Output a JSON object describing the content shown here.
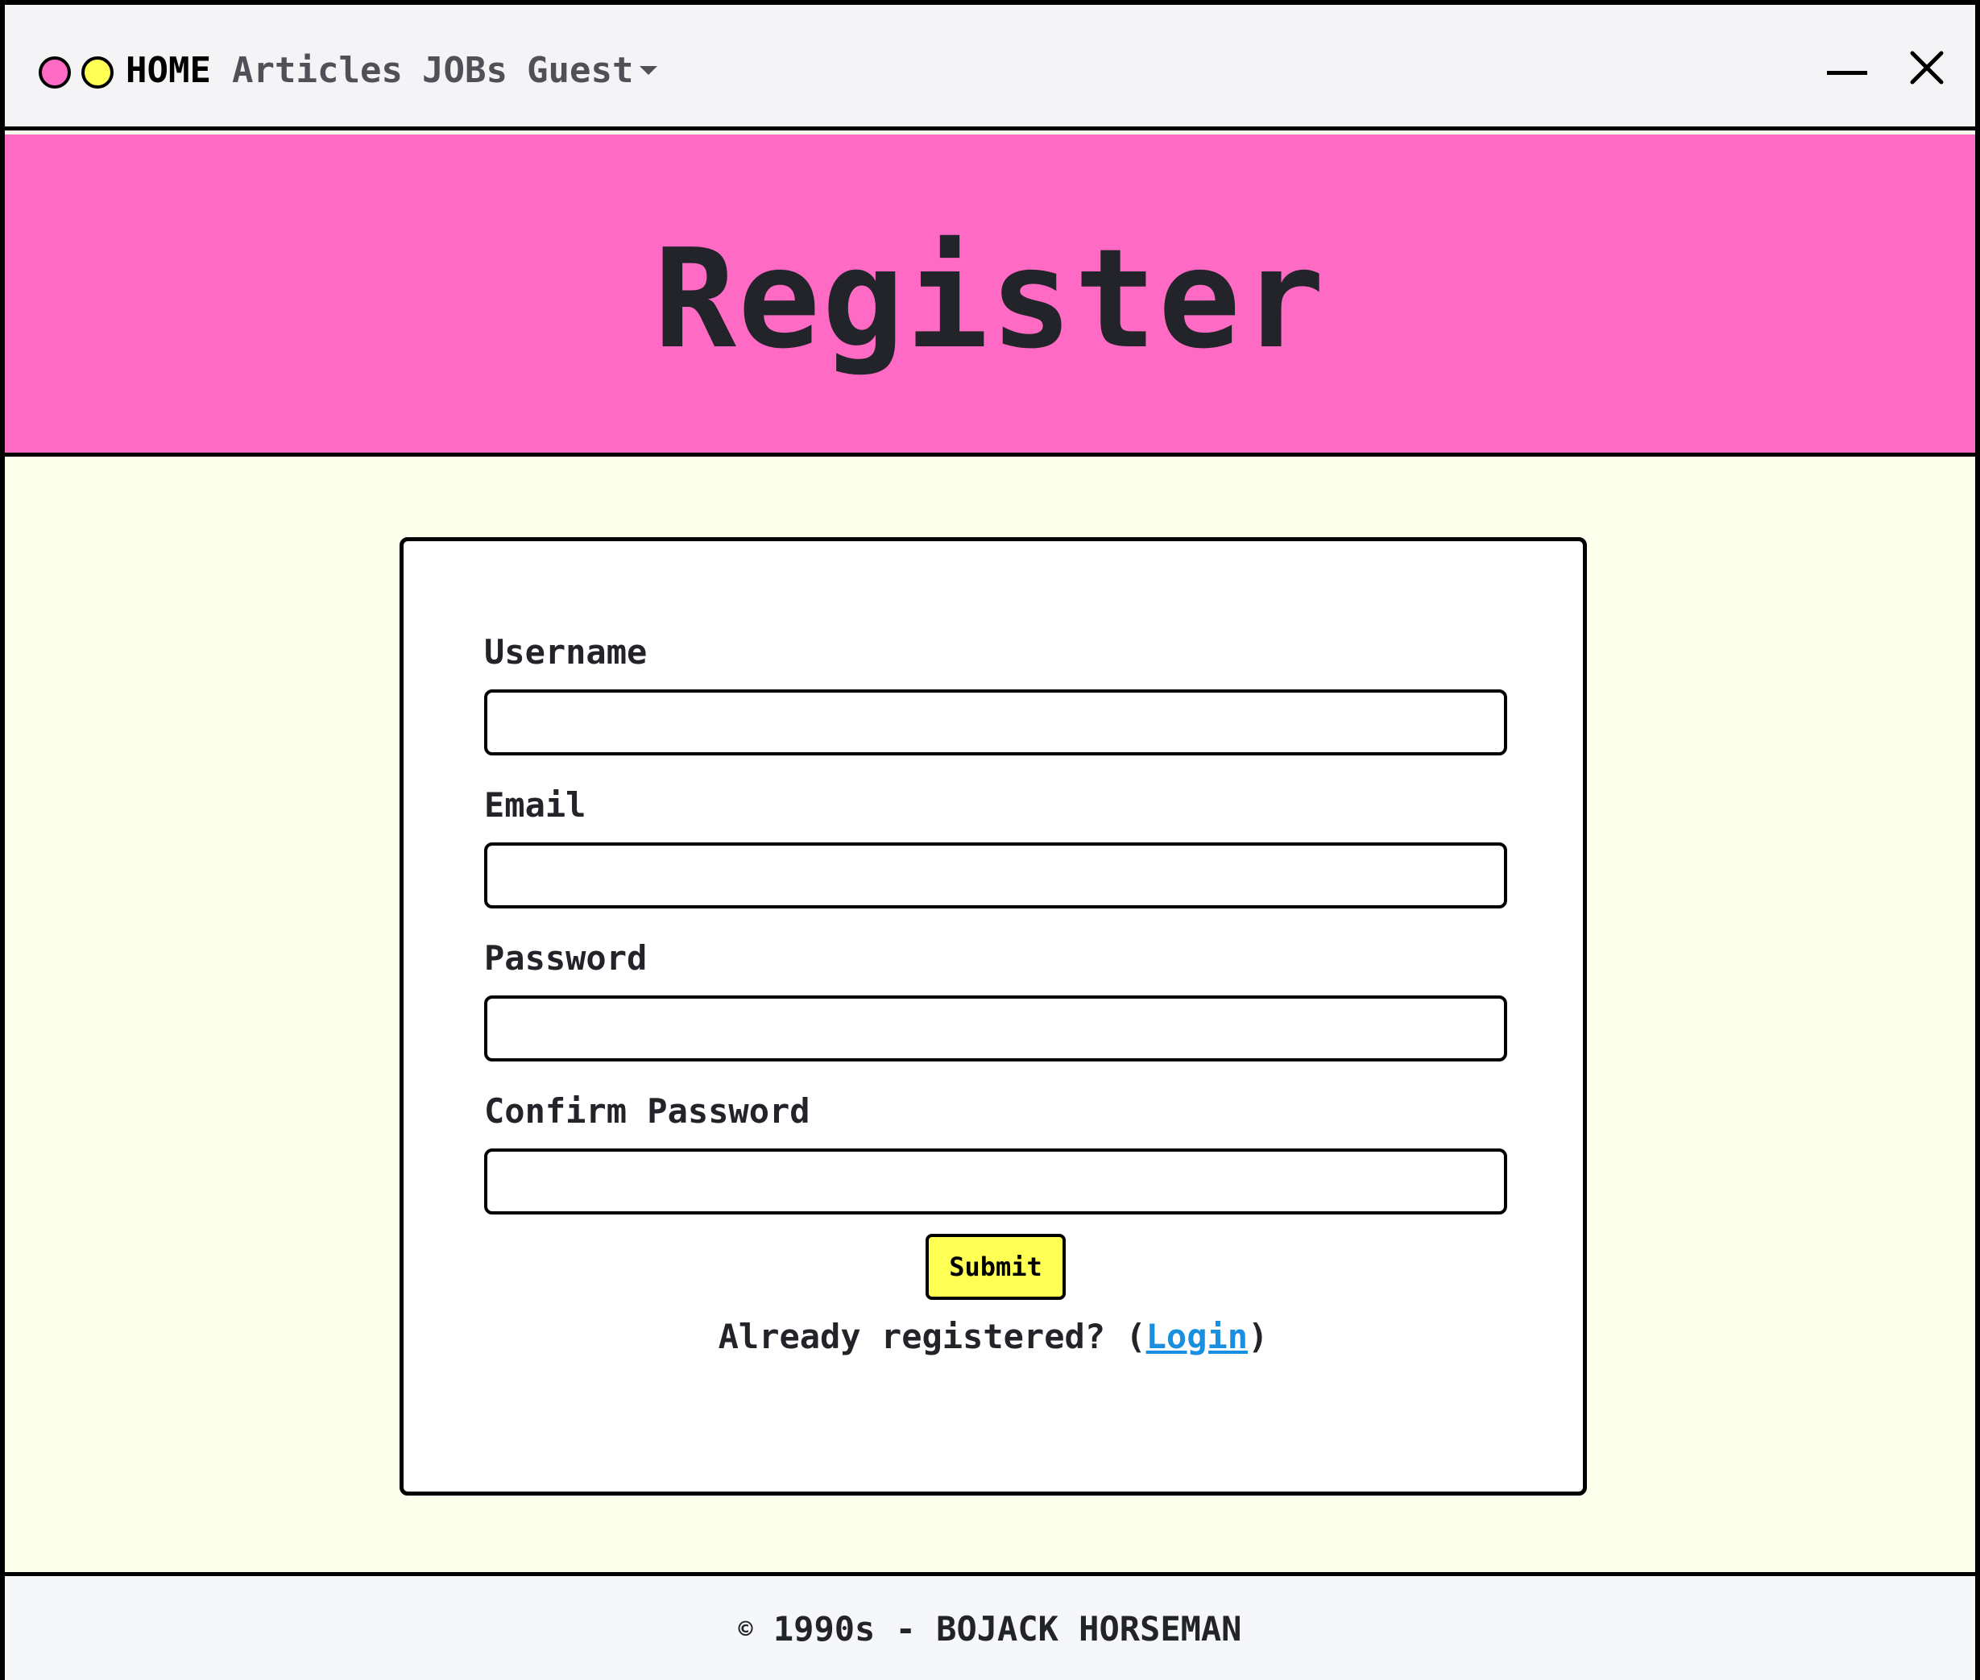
{
  "colors": {
    "accent_pink": "#ff6ac5",
    "accent_yellow": "#ffff54",
    "page_background": "#fbffec",
    "link_blue": "#1a8fe0",
    "navbar_background": "#f4f4f6"
  },
  "navbar": {
    "dots": [
      "pink-dot-icon",
      "yellow-dot-icon"
    ],
    "home": "HOME",
    "articles": "Articles",
    "jobs": "JOBs",
    "guest": "Guest",
    "guest_dropdown_icon": "caret-down-icon",
    "minimize_icon": "minimize-icon",
    "close_icon": "close-icon"
  },
  "hero": {
    "title": "Register"
  },
  "form": {
    "username_label": "Username",
    "username_value": "",
    "email_label": "Email",
    "email_value": "",
    "password_label": "Password",
    "password_value": "",
    "confirm_password_label": "Confirm Password",
    "confirm_password_value": "",
    "submit_label": "Submit",
    "already_text": "Already registered? (",
    "login_link": "Login",
    "close_paren": ")"
  },
  "footer": {
    "copyright_symbol": "©",
    "text": " 1990s - BOJACK HORSEMAN"
  }
}
